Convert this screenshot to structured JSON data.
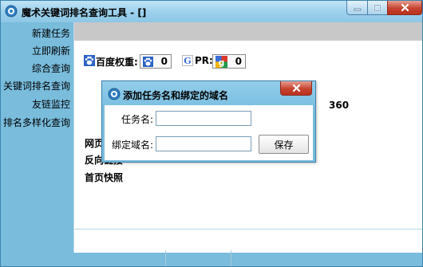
{
  "window": {
    "title": "魔术关键词排名查询工具 - []",
    "controls": {
      "minimize": "minimize",
      "maximize": "maximize",
      "close": "close"
    }
  },
  "sidebar": {
    "items": [
      {
        "label": "新建任务"
      },
      {
        "label": "立即刷新"
      },
      {
        "label": "综合查询"
      },
      {
        "label": "关键词排名查询"
      },
      {
        "label": "友链监控"
      },
      {
        "label": "排名多样化查询"
      }
    ]
  },
  "content": {
    "metrics": [
      {
        "label": "百度权重:",
        "value": "0",
        "icon": "baidu-paw-icon"
      },
      {
        "label": "PR:",
        "value": "0",
        "icon": "google-g-icon"
      }
    ],
    "column_360": "360",
    "rows": [
      "网页",
      "反向链接",
      "首页快照"
    ]
  },
  "dialog": {
    "title": "添加任务名和绑定的域名",
    "task_name_label": "任务名:",
    "task_name_value": "",
    "domain_label": "绑定域名:",
    "domain_value": "",
    "save_label": "保存"
  },
  "colors": {
    "chrome": "#79bcdc",
    "titlebar": "#9bd0ec",
    "close_button": "#c7432f",
    "content_bg": "#ffffff",
    "gray_bar": "#c8c8c8"
  }
}
